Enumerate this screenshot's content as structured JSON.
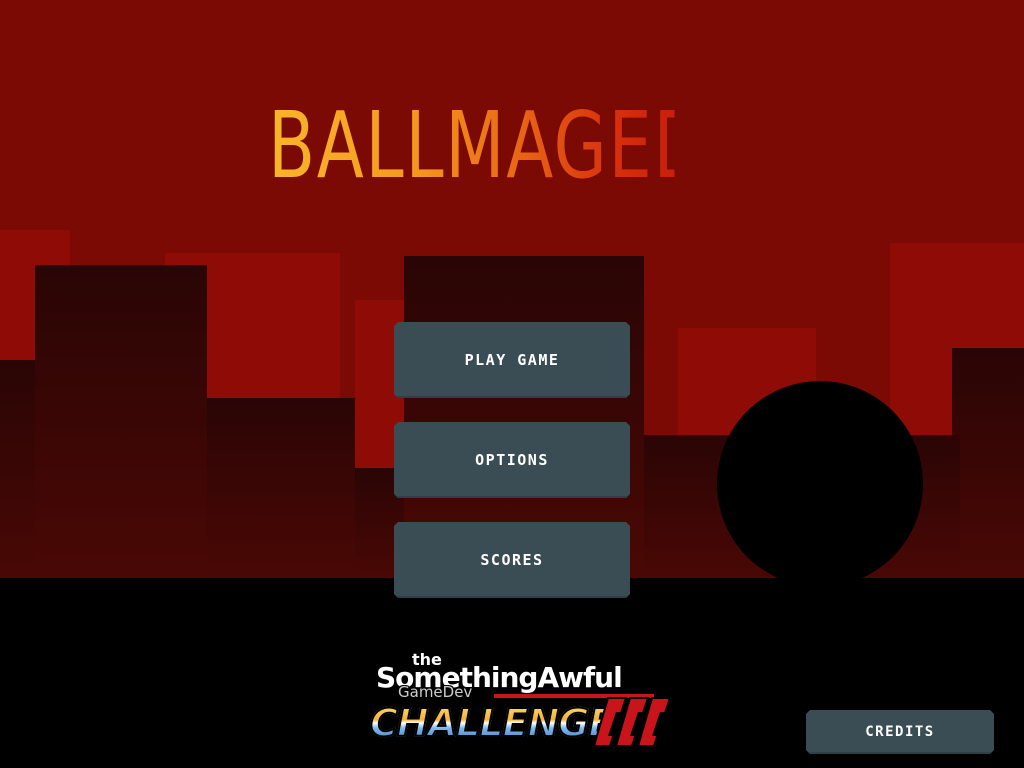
{
  "game": {
    "title": "BALLMAGEDDON"
  },
  "menu": {
    "play_label": "PLAY GAME",
    "options_label": "OPTIONS",
    "scores_label": "SCORES",
    "credits_label": "CREDITS"
  },
  "logo": {
    "the": "the",
    "something_awful": "SomethingAwful",
    "gamedev": "GameDev",
    "challenge": "CHALLENGE"
  },
  "colors": {
    "sky": "#7b0a04",
    "building_far": "#8e0c05",
    "building_mid": "#2a0505",
    "ground": "#000000",
    "button": "#3a4d55",
    "title_start": "#f8b62a",
    "title_end": "#c8200a"
  },
  "icons": {
    "ball": "black-ball",
    "logo": "something-awful-gamedev-challenge-logo"
  }
}
